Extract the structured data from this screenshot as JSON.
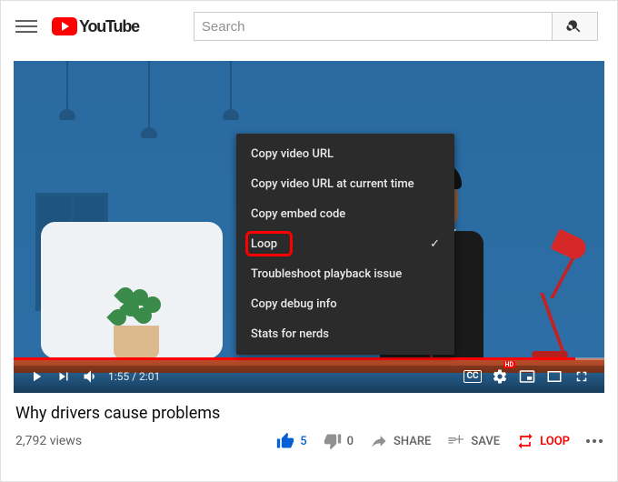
{
  "header": {
    "logo_text": "YouTube",
    "search_placeholder": "Search"
  },
  "player": {
    "time_current": "1:55",
    "time_total": "2:01",
    "hd_badge": "HD",
    "cc_badge": "CC"
  },
  "context_menu": {
    "items": [
      {
        "label": "Copy video URL"
      },
      {
        "label": "Copy video URL at current time"
      },
      {
        "label": "Copy embed code"
      },
      {
        "label": "Loop",
        "checked": true,
        "highlighted": true
      },
      {
        "label": "Troubleshoot playback issue"
      },
      {
        "label": "Copy debug info"
      },
      {
        "label": "Stats for nerds"
      }
    ]
  },
  "video": {
    "title": "Why drivers cause problems",
    "views": "2,792 views"
  },
  "actions": {
    "like_count": "5",
    "dislike_count": "0",
    "share_label": "SHARE",
    "save_label": "SAVE",
    "loop_label": "LOOP"
  }
}
